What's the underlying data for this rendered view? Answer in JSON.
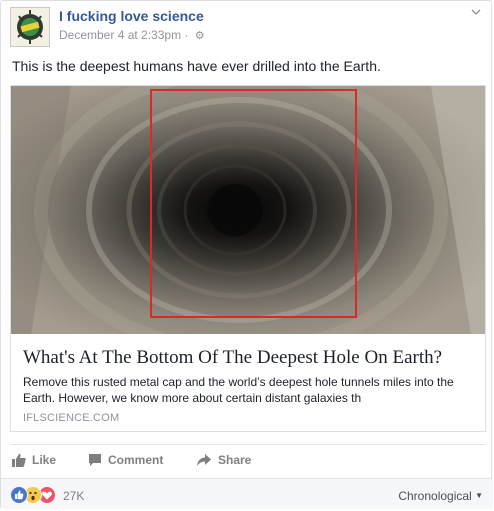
{
  "post": {
    "page_name": "I fucking love science",
    "timestamp": "December 4 at 2:33pm",
    "separator": "·",
    "privacy_icon": "gear-icon",
    "text": "This is the deepest humans have ever drilled into the Earth."
  },
  "link_preview": {
    "image_icon": "borehole-photo",
    "highlight_color": "#d92a2a",
    "title": "What's At The Bottom Of The Deepest Hole On Earth?",
    "description": "Remove this rusted metal cap and the world’s deepest hole tunnels miles into the Earth. However, we know more about certain distant galaxies th",
    "domain": "IFLSCIENCE.COM"
  },
  "actions": {
    "like_label": "Like",
    "comment_label": "Comment",
    "share_label": "Share"
  },
  "reactions": {
    "icons": [
      "like-reaction-icon",
      "wow-reaction-icon",
      "love-reaction-icon"
    ],
    "count": "27K",
    "sort_label": "Chronological"
  },
  "colors": {
    "link_blue": "#365899",
    "meta_gray": "#90949c",
    "like_blue": "#3b5998",
    "love_red": "#f25268",
    "wow_yellow": "#f7c94b"
  }
}
